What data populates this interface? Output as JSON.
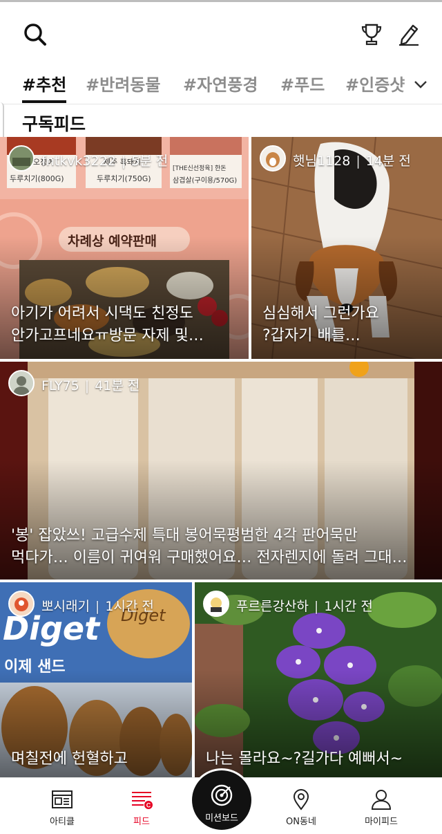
{
  "header": {
    "search_icon": "search-icon",
    "trophy_icon": "trophy-icon",
    "write_icon": "pencil-icon"
  },
  "tabs": [
    {
      "label": "#추천",
      "active": true
    },
    {
      "label": "#반려동물"
    },
    {
      "label": "#자연풍경"
    },
    {
      "label": "#푸드"
    },
    {
      "label": "#인증샷"
    }
  ],
  "section": {
    "title": "구독피드"
  },
  "cards": [
    {
      "user": "fntkvk3222",
      "time": "5분 전",
      "caption_line1": "아기가 어려서 시댁도 친정도",
      "caption_line2": "안가고프네요ㅠ방문 자제 및…",
      "image_text_main": "차례상 예약판매",
      "image_text_p1": "칠레산 오징어",
      "image_text_p1b": "두루치기(800G)",
      "image_text_p2": "제주 흑돼지",
      "image_text_p2b": "두루치기(750G)",
      "image_text_p3": "[THE신선정육] 한돈",
      "image_text_p3b": "삼겹살(구이용/570G)"
    },
    {
      "user": "햇님1128",
      "time": "14분 전",
      "caption_line1": "심심해서 그런가요",
      "caption_line2": "?갑자기 배를…"
    },
    {
      "user": "FLY75",
      "time": "41분 전",
      "caption_line1": "'봉' 잡았쓰! 고급수제 특대 봉어묵평범한 4각 판어묵만",
      "caption_line2": "먹다가… 이름이 귀여워 구매했어요… 전자렌지에 돌려 그대…"
    },
    {
      "user": "뽀시래기",
      "time": "1시간 전",
      "caption_line1": "며칠전에 헌혈하고",
      "image_text_brand": "Diget",
      "image_text_brand2": "Diget",
      "image_text_kor": "이제 샌드"
    },
    {
      "user": "푸르른강산하",
      "time": "1시간 전",
      "caption_line1": "나는 몰라요~?길가다 예뻐서~"
    }
  ],
  "bottom_nav": [
    {
      "label": "아티클",
      "icon": "article-icon"
    },
    {
      "label": "피드",
      "icon": "feed-icon",
      "active": true
    },
    {
      "label": "미션보드",
      "icon": "target-icon"
    },
    {
      "label": "ON동네",
      "icon": "location-pin-icon"
    },
    {
      "label": "마이피드",
      "icon": "person-icon"
    }
  ],
  "colors": {
    "accent": "#e60023",
    "text": "#111111",
    "inactive_tab": "#8c8c8c"
  }
}
